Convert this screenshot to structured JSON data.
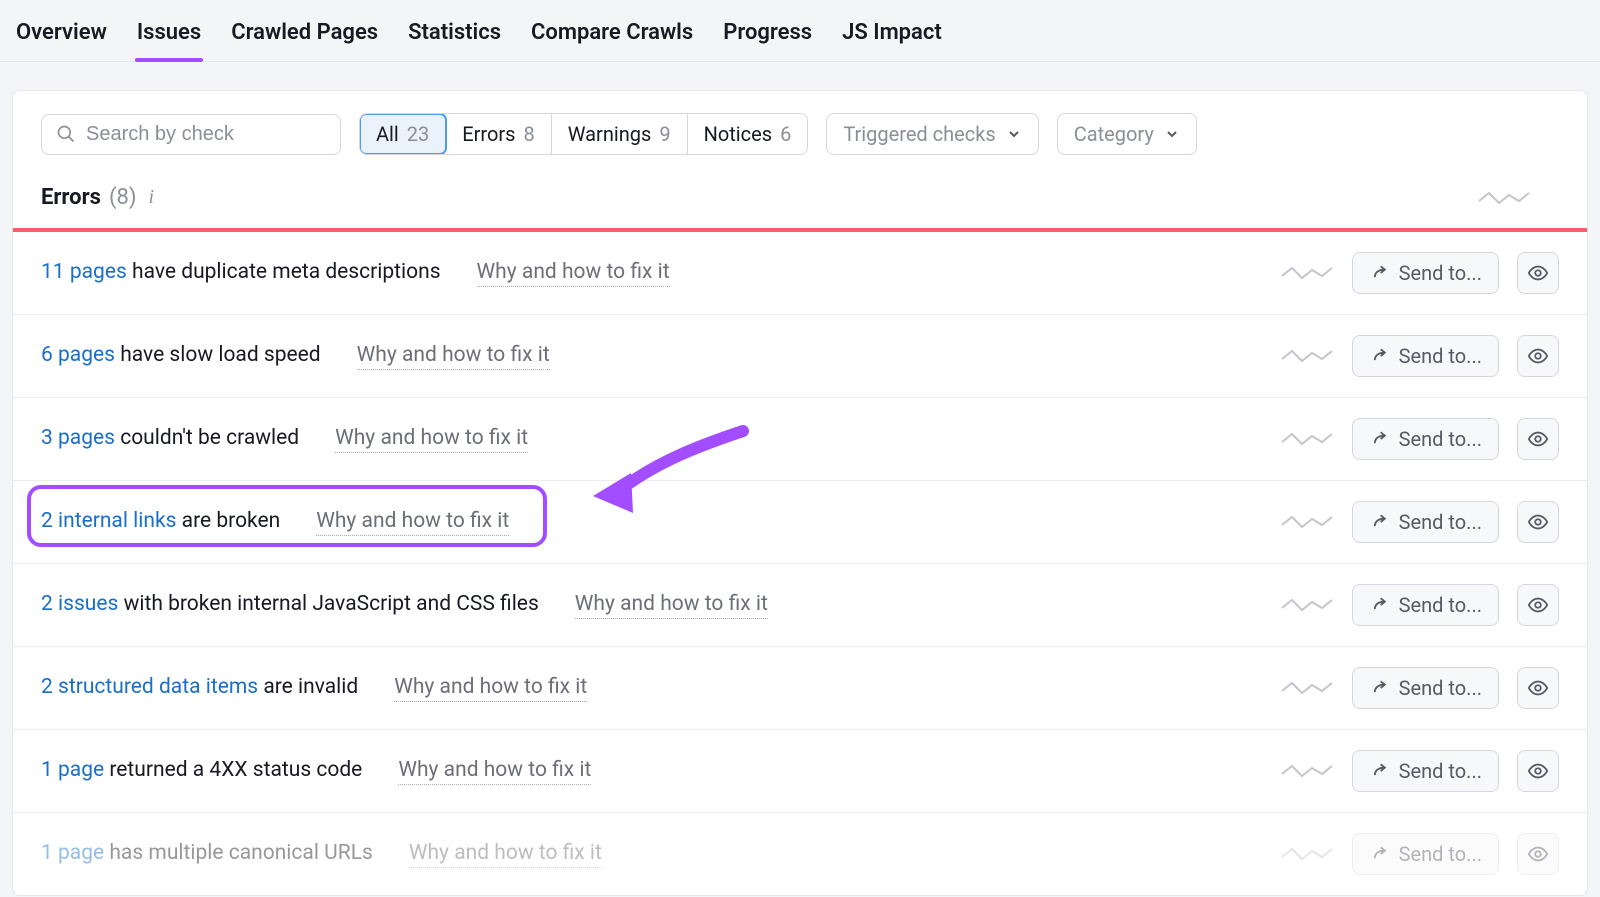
{
  "tabs": {
    "overview": "Overview",
    "issues": "Issues",
    "crawled_pages": "Crawled Pages",
    "statistics": "Statistics",
    "compare_crawls": "Compare Crawls",
    "progress": "Progress",
    "js_impact": "JS Impact"
  },
  "search": {
    "placeholder": "Search by check"
  },
  "filters": {
    "all": {
      "label": "All",
      "count": "23"
    },
    "errors": {
      "label": "Errors",
      "count": "8"
    },
    "warnings": {
      "label": "Warnings",
      "count": "9"
    },
    "notices": {
      "label": "Notices",
      "count": "6"
    }
  },
  "dropdowns": {
    "triggered": "Triggered checks",
    "category": "Category"
  },
  "section": {
    "title": "Errors",
    "count": "(8)"
  },
  "fix_label": "Why and how to fix it",
  "send_to_label": "Send to...",
  "issues": [
    {
      "link": "11 pages",
      "desc": " have duplicate meta descriptions"
    },
    {
      "link": "6 pages",
      "desc": " have slow load speed"
    },
    {
      "link": "3 pages",
      "desc": " couldn't be crawled"
    },
    {
      "link": "2 internal links",
      "desc": " are broken"
    },
    {
      "link": "2 issues",
      "desc": " with broken internal JavaScript and CSS files"
    },
    {
      "link": "2 structured data items",
      "desc": " are invalid"
    },
    {
      "link": "1 page",
      "desc": " returned a 4XX status code"
    },
    {
      "link": "1 page",
      "desc": " has multiple canonical URLs"
    }
  ]
}
